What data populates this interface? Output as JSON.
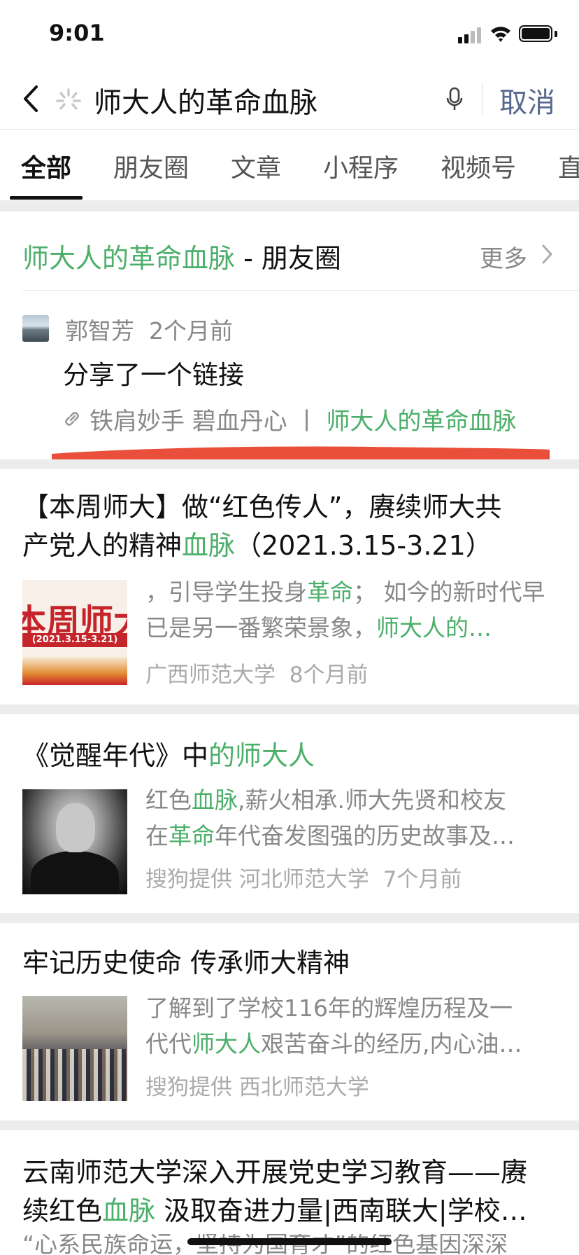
{
  "status_bar": {
    "time": "9:01"
  },
  "search": {
    "query": "师大人的革命血脉",
    "cancel_label": "取消"
  },
  "tabs": [
    "全部",
    "朋友圈",
    "文章",
    "小程序",
    "视频号",
    "直"
  ],
  "moments": {
    "title_highlight": "师大人的革命血脉",
    "title_rest": " - 朋友圈",
    "more_label": "更多",
    "post": {
      "author": "郭智芳",
      "time": "2个月前",
      "text": "分享了一个链接",
      "link_prefix": "铁肩妙手 碧血丹心",
      "link_separator": "丨",
      "link_highlight": "师大人的革命血脉"
    }
  },
  "results": [
    {
      "title_line1": "【本周师大】做“红色传人”，赓续师大共",
      "title_line2_a": "产党人的精神",
      "title_line2_hl": "血脉",
      "title_line2_b": "（2021.3.15-3.21）",
      "snippet_a": "，引导学生投身",
      "snippet_hl1": "革命",
      "snippet_b": "； 如今的新时代早已是另一番繁荣景象，",
      "snippet_hl2": "师大人的…",
      "thumb_text": "本周师大",
      "thumb_band": "(2021.3.15-3.21)",
      "source": "广西师范大学",
      "time": "8个月前"
    },
    {
      "title_a": "《觉醒年代》中",
      "title_hl": "的师大人",
      "snippet_a": "红色",
      "snippet_hl1": "血脉",
      "snippet_b": ",薪火相承.师大先贤和校友",
      "snippet_c": "在",
      "snippet_hl2": "革命",
      "snippet_d": "年代奋发图强的历史故事及…",
      "provider": "搜狗提供",
      "source": "河北师范大学",
      "time": "7个月前"
    },
    {
      "title": "牢记历史使命 传承师大精神",
      "snippet_a": "了解到了学校116年的辉煌历程及一",
      "snippet_b": "代代",
      "snippet_hl": "师大人",
      "snippet_c": "艰苦奋斗的经历,内心油…",
      "provider": "搜狗提供",
      "source": "西北师范大学"
    },
    {
      "title_line1": "云南师范大学深入开展党史学习教育——赓",
      "title_line2_a": "续红色",
      "title_line2_hl": "血脉",
      "title_line2_b": " 汲取奋进力量|西南联大|学校…",
      "snippet_partial": "“心系民族命运，坚持为国育才”的红色基因深深"
    }
  ],
  "colors": {
    "highlight": "#4caf6a",
    "cancel": "#56698f",
    "annotation": "#e8462f"
  }
}
